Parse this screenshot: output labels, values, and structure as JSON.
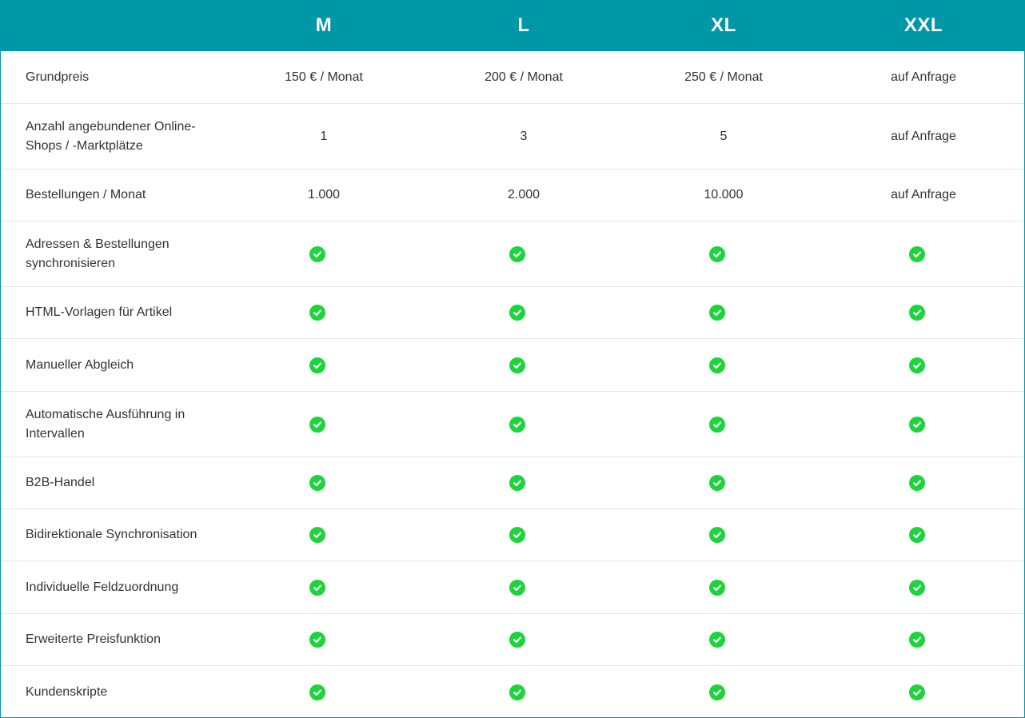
{
  "plans": [
    "M",
    "L",
    "XL",
    "XXL"
  ],
  "rows": [
    {
      "label": "Grundpreis",
      "values": [
        "150 € / Monat",
        "200 € / Monat",
        "250 € / Monat",
        "auf Anfrage"
      ]
    },
    {
      "label": "Anzahl angebundener Online-Shops / -Marktplätze",
      "values": [
        "1",
        "3",
        "5",
        "auf Anfrage"
      ]
    },
    {
      "label": "Bestellungen / Monat",
      "values": [
        "1.000",
        "2.000",
        "10.000",
        "auf Anfrage"
      ]
    },
    {
      "label": "Adressen & Bestellungen synchronisieren",
      "check": true
    },
    {
      "label": "HTML-Vorlagen für Artikel",
      "check": true
    },
    {
      "label": "Manueller Abgleich",
      "check": true
    },
    {
      "label": "Automatische Ausführung in Intervallen",
      "check": true
    },
    {
      "label": "B2B-Handel",
      "check": true
    },
    {
      "label": "Bidirektionale Synchronisation",
      "check": true
    },
    {
      "label": "Individuelle Feldzuordnung",
      "check": true
    },
    {
      "label": "Erweiterte Preisfunktion",
      "check": true
    },
    {
      "label": "Kundenskripte",
      "check": true
    }
  ],
  "icons": {
    "check": "check-circle-icon"
  },
  "colors": {
    "header_bg": "#0097a7",
    "check": "#1ed43c",
    "divider": "#e6e6e6"
  }
}
